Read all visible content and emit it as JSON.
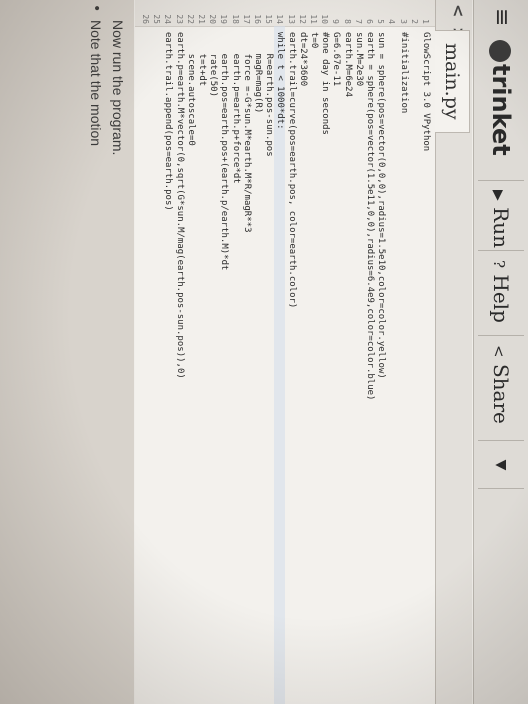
{
  "toolbar": {
    "menu_icon": "hamburger-menu-icon",
    "logo_text": "trinket",
    "run_label": "Run",
    "help_label": "Help",
    "share_label": "Share",
    "run_glyph": "▶",
    "help_glyph": "?",
    "share_glyph": "<",
    "caret_glyph": "▼"
  },
  "tabs": {
    "nav": "< >",
    "file_name": "main.py"
  },
  "editor": {
    "active_line": 14,
    "lines": [
      {
        "n": "1",
        "code": "GlowScript 3.0 VPython"
      },
      {
        "n": "2",
        "code": ""
      },
      {
        "n": "3",
        "code": "#initialization"
      },
      {
        "n": "4",
        "code": ""
      },
      {
        "n": "5",
        "code": "sun = sphere(pos=vector(0,0,0),radius=1.5e10,color=color.yellow)"
      },
      {
        "n": "6",
        "code": "earth = sphere(pos=vector(1.5e11,0,0),radius=6.4e9,color=color.blue)"
      },
      {
        "n": "7",
        "code": "sun.M=2e30"
      },
      {
        "n": "8",
        "code": "earth.M=6e24"
      },
      {
        "n": "9",
        "code": "G=6.67e-11"
      },
      {
        "n": "10",
        "code": "#one day in seconds"
      },
      {
        "n": "11",
        "code": "t=0"
      },
      {
        "n": "12",
        "code": "dt=24*3600"
      },
      {
        "n": "13",
        "code": "earth.trail=curve(pos=earth.pos, color=earth.color)"
      },
      {
        "n": "14",
        "code": "while t < 1000*dt:"
      },
      {
        "n": "15",
        "code": "    R=earth.pos-sun.pos"
      },
      {
        "n": "16",
        "code": "    magR=mag(R)"
      },
      {
        "n": "17",
        "code": "    force =-G*sun.M*earth.M*R/magR**3"
      },
      {
        "n": "18",
        "code": "    earth.p=earth.p+force*dt"
      },
      {
        "n": "19",
        "code": "    earth.pos=earth.pos+(earth.p/earth.M)*dt"
      },
      {
        "n": "20",
        "code": "    rate(50)"
      },
      {
        "n": "21",
        "code": "    t=t+dt"
      },
      {
        "n": "22",
        "code": "    scene.autoscale=0"
      },
      {
        "n": "23",
        "code": "earth.p=earth.M*vector(0,sqrt(G*sun.M/mag(earth.pos-sun.pos)),0)"
      },
      {
        "n": "24",
        "code": "earth.trail.append(pos=earth.pos)"
      },
      {
        "n": "25",
        "code": ""
      },
      {
        "n": "26",
        "code": ""
      }
    ]
  },
  "instructions": {
    "line1": "Now run the program.",
    "line2": "Note that the motion"
  }
}
